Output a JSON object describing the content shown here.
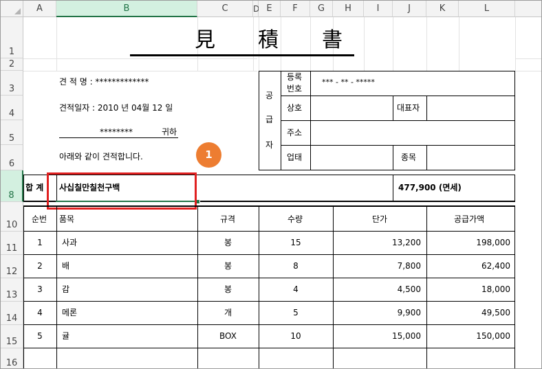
{
  "columns": [
    "A",
    "B",
    "C",
    "D",
    "E",
    "F",
    "G",
    "H",
    "I",
    "J",
    "K",
    "L"
  ],
  "rows": [
    "1",
    "2",
    "3",
    "4",
    "5",
    "6",
    "8",
    "10",
    "11",
    "12",
    "13",
    "14",
    "15",
    "16"
  ],
  "doc": {
    "title": [
      "見",
      "積",
      "書"
    ],
    "estimate_name": "견 적 명 : *************",
    "estimate_date": "견적일자 : 2010  년  04월   12 일",
    "recipient_name": "********",
    "recipient_suffix": "귀하",
    "intro": "아래와 같이 견적합니다.",
    "supplier_label": [
      "공",
      "급",
      "자"
    ],
    "reg_label_1": "등록",
    "reg_label_2": "번호",
    "reg_value": "*** - ** - *****",
    "company_label": "상호",
    "ceo_label": "대표자",
    "address_label": "주소",
    "business_type_label": "업태",
    "business_item_label": "종목"
  },
  "total": {
    "label": "합 계",
    "amount_korean": "사십칠만칠천구백",
    "amount": "477,900 (면세)"
  },
  "table": {
    "headers": [
      "순번",
      "품목",
      "규격",
      "수량",
      "단가",
      "공급가액"
    ],
    "rows": [
      {
        "no": "1",
        "item": "사과",
        "spec": "봉",
        "qty": "15",
        "price": "13,200",
        "supply": "198,000"
      },
      {
        "no": "2",
        "item": "배",
        "spec": "봉",
        "qty": "8",
        "price": "7,800",
        "supply": "62,400"
      },
      {
        "no": "3",
        "item": "감",
        "spec": "봉",
        "qty": "4",
        "price": "4,500",
        "supply": "18,000"
      },
      {
        "no": "4",
        "item": "메론",
        "spec": "개",
        "qty": "5",
        "price": "9,900",
        "supply": "49,500"
      },
      {
        "no": "5",
        "item": "귤",
        "spec": "BOX",
        "qty": "10",
        "price": "15,000",
        "supply": "150,000"
      }
    ]
  },
  "callout": {
    "number": "1",
    "color": "#ed7d31",
    "box_color": "#e02020"
  },
  "accent_color": "#217346"
}
